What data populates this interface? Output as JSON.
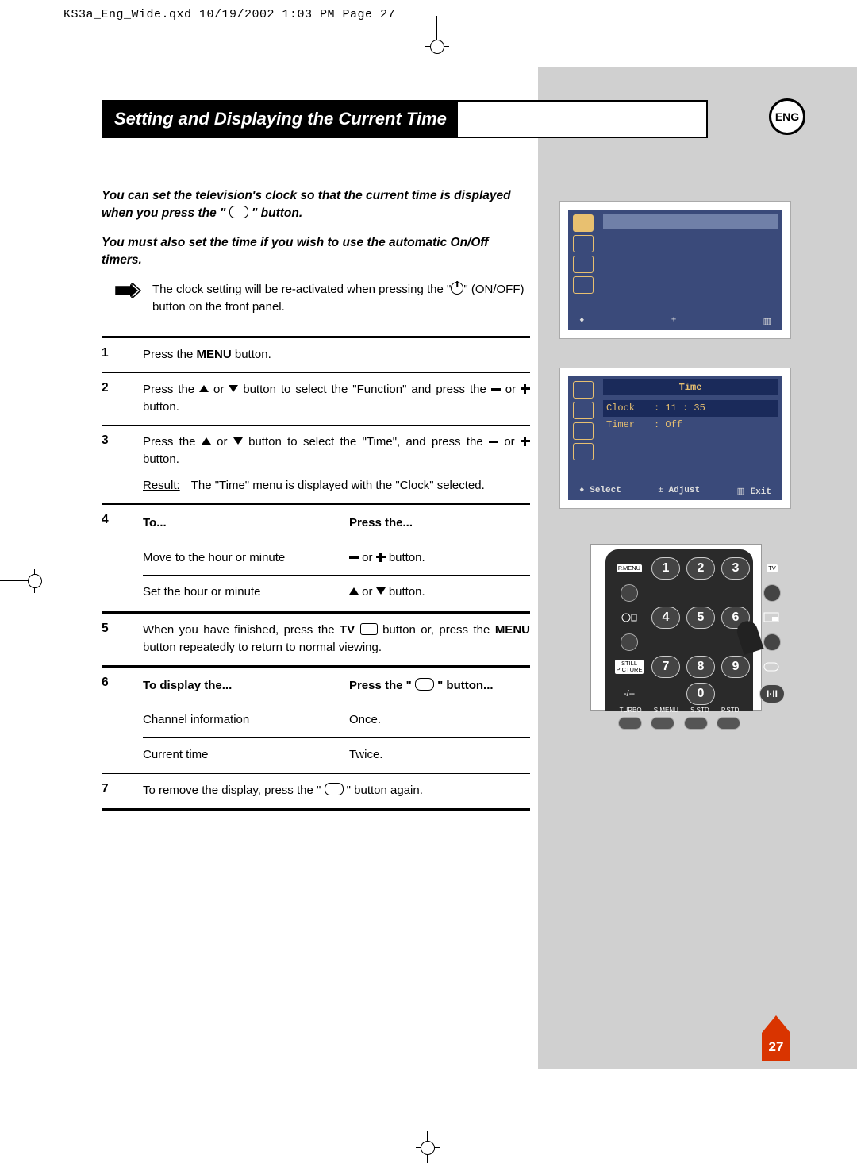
{
  "print_header": "KS3a_Eng_Wide.qxd  10/19/2002  1:03 PM  Page 27",
  "lang_badge": "ENG",
  "title": "Setting and Displaying the Current Time",
  "intro1a": "You can set the television's clock so that the current time is displayed when you press the \" ",
  "intro1b": " \" button.",
  "intro2": "You must also set the time if you wish to use the automatic On/Off timers.",
  "note": "The clock setting will be re-activated when pressing the \"",
  "note_after": "\" (ON/OFF) button on the front panel.",
  "steps": {
    "s1": "Press the ",
    "s1_menu": "MENU",
    "s1b": " button.",
    "s2a": "Press the ",
    "s2b": " or ",
    "s2c": " button to select the \"Function\" and press the ",
    "s2d": " or ",
    "s2e": " button.",
    "s3a": "Press the ",
    "s3b": " or ",
    "s3c": " button to select the \"Time\", and press the ",
    "s3d": " or ",
    "s3e": " button.",
    "s3_result_lbl": "Result:",
    "s3_result": "The \"Time\" menu is displayed with the \"Clock\" selected.",
    "s4_to": "To...",
    "s4_press": "Press the...",
    "s4_r1a": "Move to the hour or minute",
    "s4_r1b_or": " or ",
    "s4_r1b_end": " button.",
    "s4_r2a": "Set the hour or minute",
    "s4_r2b_or": " or ",
    "s4_r2b_end": " button.",
    "s5a": "When you have finished, press the ",
    "s5_tv": "TV",
    "s5b": " button or, press the ",
    "s5_menu": "MENU",
    "s5c": " button repeatedly to return to normal viewing.",
    "s6_to": "To display the...",
    "s6_press_a": "Press the \" ",
    "s6_press_b": " \" button...",
    "s6_r1a": "Channel information",
    "s6_r1b": "Once.",
    "s6_r2a": "Current time",
    "s6_r2b": "Twice.",
    "s7a": "To remove the display, press the \" ",
    "s7b": " \" button again."
  },
  "osd": {
    "time_title": "Time",
    "clock_lbl": "Clock",
    "clock_val": ": 11 : 35",
    "timer_lbl": "Timer",
    "timer_val": ": Off",
    "bottom": {
      "select": "Select",
      "adjust": "Adjust",
      "exit": "Exit"
    },
    "bottom_sym": {
      "select": "♦",
      "adjust": "±",
      "exit": "▥"
    }
  },
  "remote": {
    "nums": [
      "1",
      "2",
      "3",
      "4",
      "5",
      "6",
      "7",
      "8",
      "9",
      "0"
    ],
    "left_labels": [
      "P.MENU",
      "",
      "",
      "STILL\nPICTURE",
      "-/--"
    ],
    "right_labels": [
      "TV",
      "",
      "",
      "",
      "I·II"
    ],
    "bottom_labels": [
      "TURBO",
      "S.MENU",
      "S.STD",
      "P.STD"
    ]
  },
  "page_number": "27"
}
